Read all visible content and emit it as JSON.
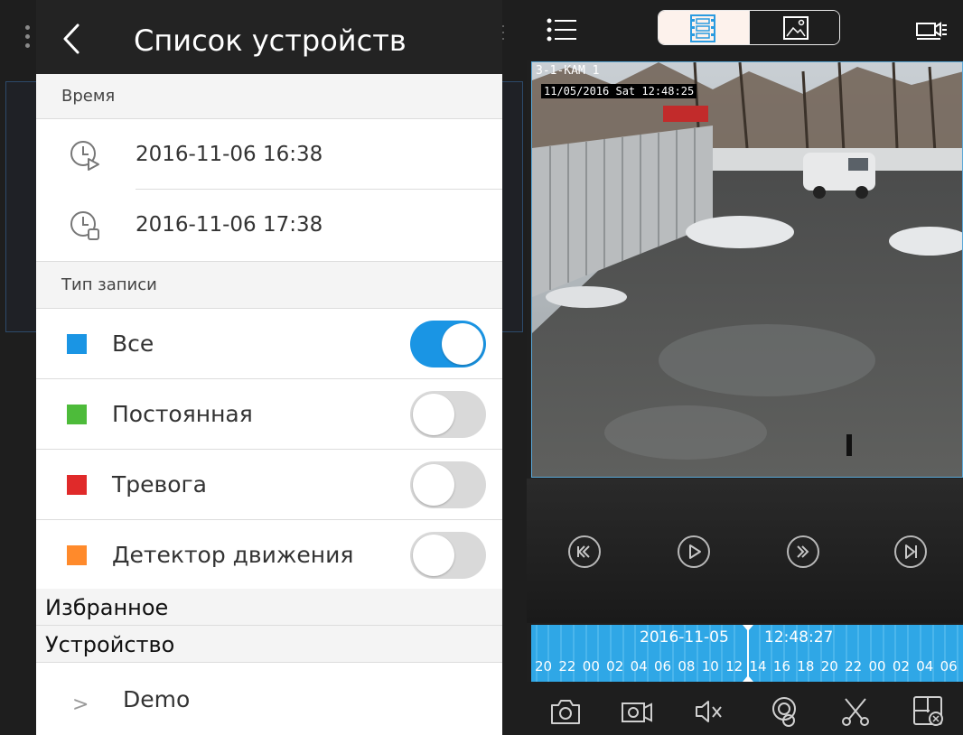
{
  "header": {
    "title": "Список устройств"
  },
  "sections": {
    "time": "Время",
    "record_type": "Тип записи",
    "favorites": "Избранное",
    "device": "Устройство"
  },
  "time_range": {
    "start": "2016-11-06 16:38",
    "end": "2016-11-06 17:38"
  },
  "record_types": [
    {
      "label": "Все",
      "color": "#1a95e4",
      "enabled": true
    },
    {
      "label": "Постоянная",
      "color": "#4dbb3a",
      "enabled": false
    },
    {
      "label": "Тревога",
      "color": "#e02a2a",
      "enabled": false
    },
    {
      "label": "Детектор движения",
      "color": "#ff8a2b",
      "enabled": false
    }
  ],
  "devices": [
    {
      "name": "Demo"
    }
  ],
  "player": {
    "camera_label": "3-1-KAM 1",
    "osd_timestamp": "11/05/2016 Sat 12:48:25",
    "timeline_date": "2016-11-05",
    "timeline_time": "12:48:27",
    "timeline_hours": [
      "20",
      "22",
      "00",
      "02",
      "04",
      "06",
      "08",
      "10",
      "12",
      "14",
      "16",
      "18",
      "20",
      "22",
      "00",
      "02",
      "04",
      "06"
    ]
  },
  "colors": {
    "accent": "#1a95e4",
    "timeline": "#2fa7e6",
    "header_bg": "#232323"
  },
  "icons": {
    "back": "chevron-left-icon",
    "start_time": "clock-play-icon",
    "end_time": "clock-stop-icon",
    "menu": "list-icon",
    "playback_mode": "film-grid-icon",
    "image_mode": "image-icon",
    "camera_list": "camera-list-icon",
    "rewind": "rewind-icon",
    "play": "play-icon",
    "fast_forward": "fast-forward-icon",
    "next_frame": "next-frame-icon",
    "snapshot": "camera-icon",
    "record": "video-record-icon",
    "mute": "speaker-mute-icon",
    "talk": "webcam-icon",
    "clip": "scissors-icon",
    "close_window": "window-close-icon"
  }
}
